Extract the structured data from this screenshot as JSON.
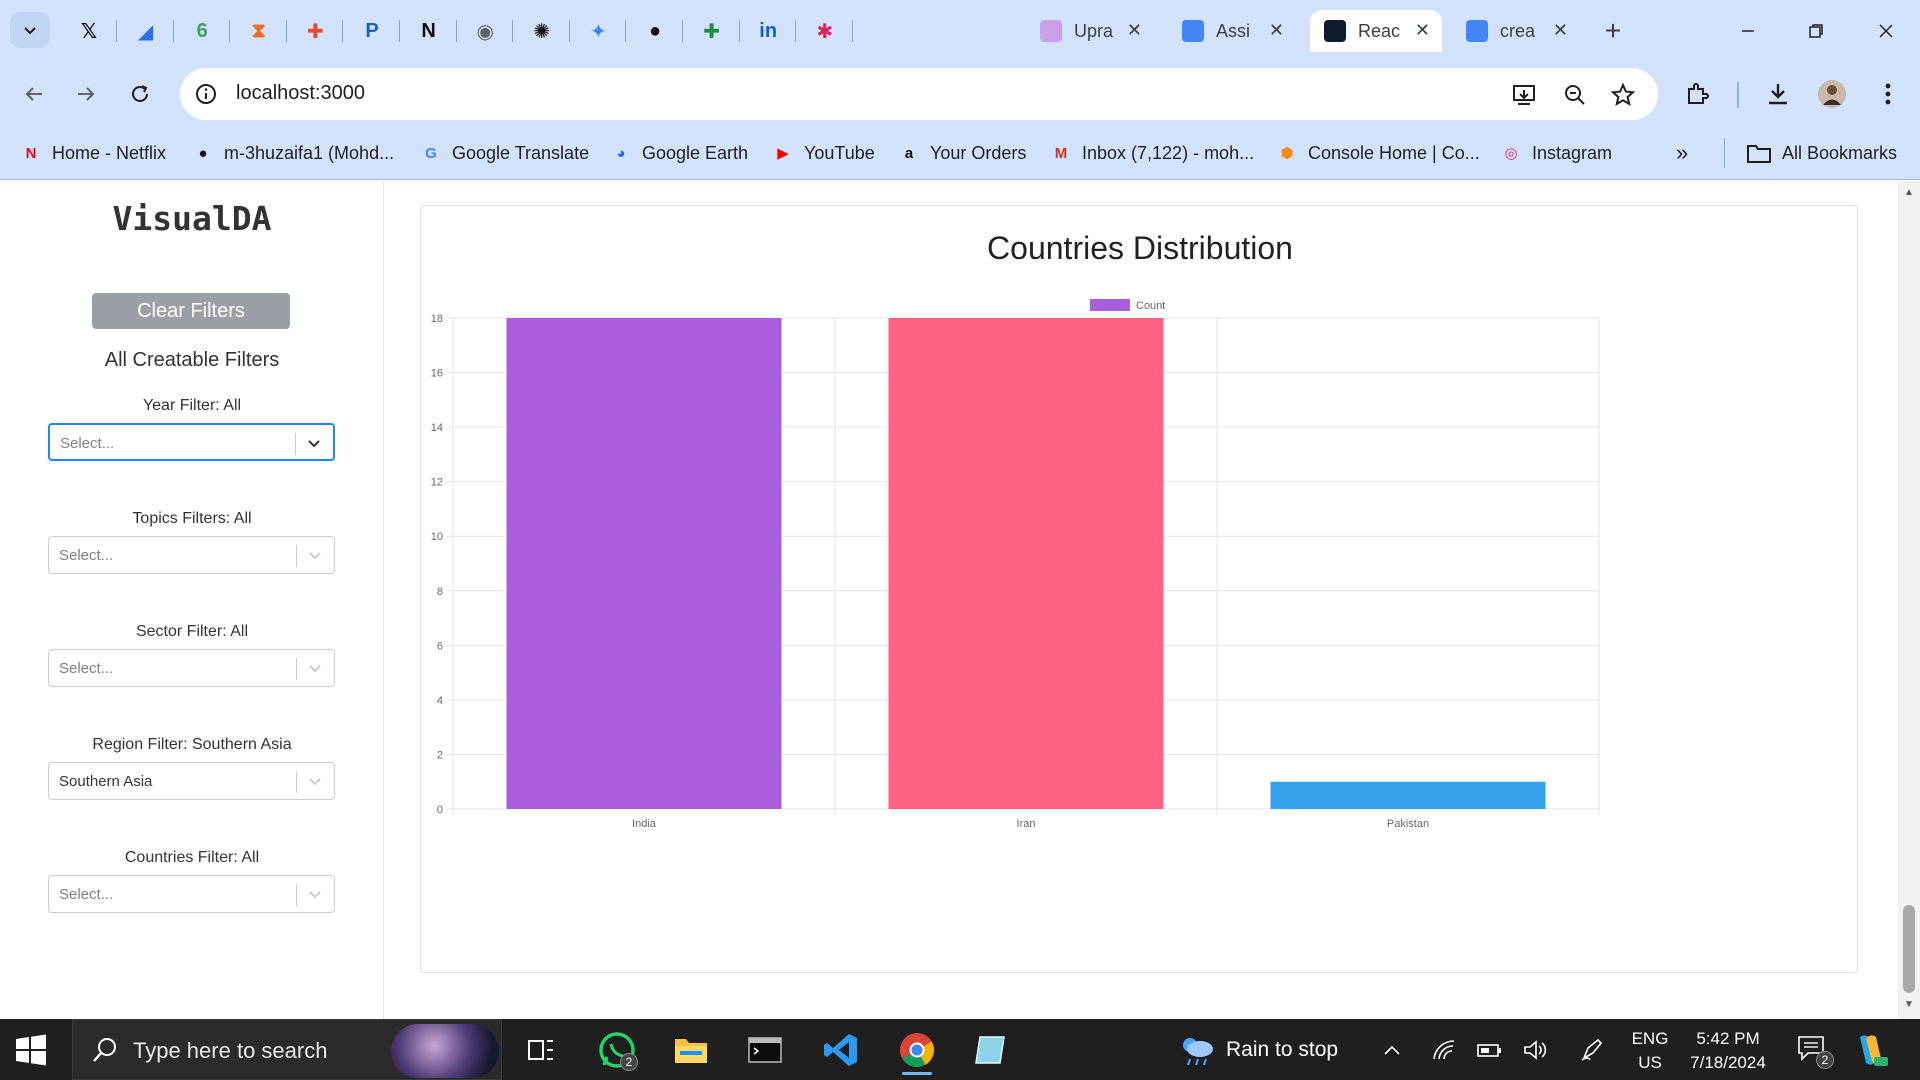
{
  "browser": {
    "pinned_tabs": [
      {
        "name": "x-icon",
        "glyph": "𝕏",
        "color": "#000000"
      },
      {
        "name": "app-icon-1",
        "glyph": "◢",
        "color": "#2f6fe4"
      },
      {
        "name": "app-icon-2",
        "glyph": "6",
        "color": "#3aa655"
      },
      {
        "name": "app-icon-3",
        "glyph": "⧗",
        "color": "#f36b21"
      },
      {
        "name": "figma-icon",
        "glyph": "✚",
        "color": "#e64a2e"
      },
      {
        "name": "paypal-icon",
        "glyph": "P",
        "color": "#1565c0"
      },
      {
        "name": "notion-icon",
        "glyph": "N",
        "color": "#111111"
      },
      {
        "name": "globe-icon",
        "glyph": "◉",
        "color": "#5f6368"
      },
      {
        "name": "chatgpt-icon",
        "glyph": "✺",
        "color": "#111111"
      },
      {
        "name": "gemini-icon",
        "glyph": "✦",
        "color": "#3b82f6"
      },
      {
        "name": "github-icon",
        "glyph": "●",
        "color": "#111111"
      },
      {
        "name": "sheets-icon",
        "glyph": "✚",
        "color": "#1e8e3e"
      },
      {
        "name": "linkedin-icon",
        "glyph": "in",
        "color": "#0a66c2"
      },
      {
        "name": "slack-icon",
        "glyph": "✱",
        "color": "#e01e5a"
      }
    ],
    "tabs": [
      {
        "title": "Upra",
        "icon": "upraised-icon",
        "icon_color": "#c7a2e8",
        "close": "✕"
      },
      {
        "title": "Assi",
        "icon": "docs-icon",
        "icon_color": "#4285f4",
        "close": "✕"
      },
      {
        "title": "Reac",
        "icon": "react-icon",
        "icon_color": "#0d1b2a",
        "close": "✕",
        "active": true
      },
      {
        "title": "crea",
        "icon": "google-icon",
        "icon_color": "#4285f4",
        "close": "✕"
      }
    ],
    "url": "localhost:3000",
    "bookmarks": [
      {
        "label": "Home - Netflix",
        "icon": "netflix-icon",
        "glyph": "N",
        "color": "#e50914"
      },
      {
        "label": "m-3huzaifa1 (Mohd...",
        "icon": "github-icon",
        "glyph": "●",
        "color": "#111111"
      },
      {
        "label": "Google Translate",
        "icon": "translate-icon",
        "glyph": "G",
        "color": "#4285f4"
      },
      {
        "label": "Google Earth",
        "icon": "earth-icon",
        "glyph": "◕",
        "color": "#1a73e8"
      },
      {
        "label": "YouTube",
        "icon": "youtube-icon",
        "glyph": "▶",
        "color": "#ff0000"
      },
      {
        "label": "Your Orders",
        "icon": "amazon-icon",
        "glyph": "a",
        "color": "#111111"
      },
      {
        "label": "Inbox (7,122) - moh...",
        "icon": "gmail-icon",
        "glyph": "M",
        "color": "#d93025"
      },
      {
        "label": "Console Home | Co...",
        "icon": "aws-icon",
        "glyph": "⬢",
        "color": "#f28b20"
      },
      {
        "label": "Instagram",
        "icon": "instagram-icon",
        "glyph": "◎",
        "color": "#d62976"
      }
    ],
    "bookmarks_more": "»",
    "all_bookmarks": "All Bookmarks"
  },
  "sidebar": {
    "brand": "VisualDA",
    "clear_button": "Clear Filters",
    "heading": "All Creatable Filters",
    "filters": [
      {
        "label": "Year Filter: All",
        "value": "",
        "placeholder": "Select...",
        "focused": true
      },
      {
        "label": "Topics Filters: All",
        "value": "",
        "placeholder": "Select...",
        "focused": false
      },
      {
        "label": "Sector Filter: All",
        "value": "",
        "placeholder": "Select...",
        "focused": false
      },
      {
        "label": "Region Filter: Southern Asia",
        "value": "Southern Asia",
        "placeholder": "Select...",
        "focused": false
      },
      {
        "label": "Countries Filter: All",
        "value": "",
        "placeholder": "Select...",
        "focused": false
      }
    ]
  },
  "chart_data": {
    "type": "bar",
    "title": "Countries Distribution",
    "categories": [
      "India",
      "Iran",
      "Pakistan"
    ],
    "series": [
      {
        "name": "Count",
        "values": [
          18,
          18,
          1
        ]
      }
    ],
    "bar_colors": [
      "#a95edb",
      "#ff6384",
      "#36a2eb"
    ],
    "legend_color": "#a95edb",
    "legend_position": "top",
    "ylim": [
      0,
      18
    ],
    "yticks": [
      0,
      2,
      4,
      6,
      8,
      10,
      12,
      14,
      16,
      18
    ],
    "grid": true,
    "xlabel": "",
    "ylabel": ""
  },
  "taskbar": {
    "search_placeholder": "Type here to search",
    "whatsapp_badge": "2",
    "weather": "Rain to stop",
    "lang_line1": "ENG",
    "lang_line2": "US",
    "time": "5:42 PM",
    "date": "7/18/2024",
    "notification_badge": "2"
  }
}
